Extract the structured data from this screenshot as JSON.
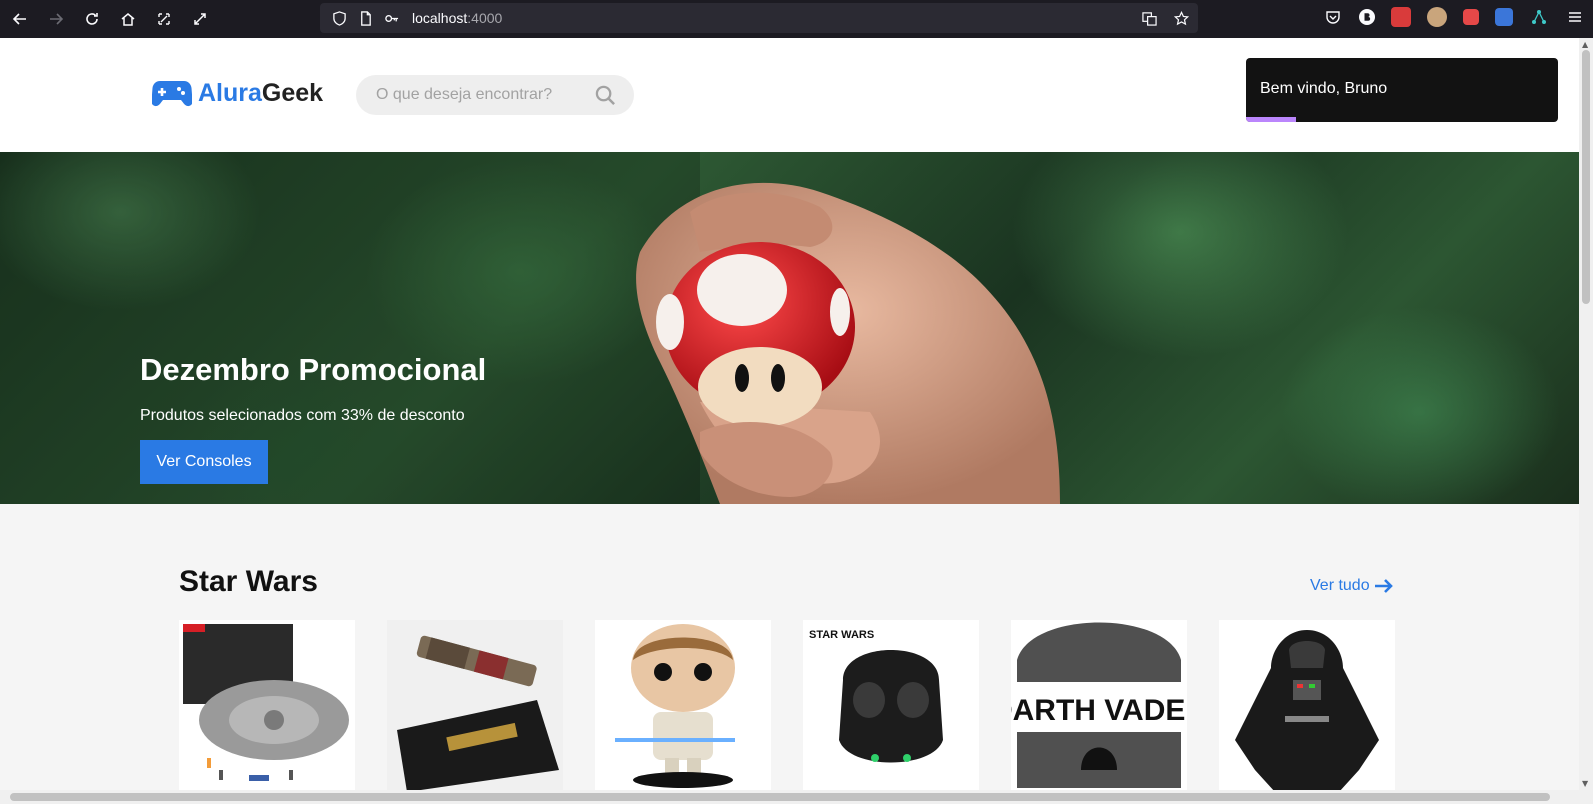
{
  "browser": {
    "url_host": "localhost",
    "url_port": ":4000"
  },
  "header": {
    "logo_prefix": "Alura",
    "logo_suffix": "Geek",
    "search_placeholder": "O que deseja encontrar?"
  },
  "toast": {
    "message": "Bem vindo, Bruno",
    "progress": 0.16
  },
  "hero": {
    "title": "Dezembro Promocional",
    "subtitle": "Produtos selecionados com 33% de desconto",
    "button_label": "Ver Consoles"
  },
  "section": {
    "title": "Star Wars",
    "see_all_label": "Ver tudo"
  },
  "products": {
    "helmet_brand_label": "STAR WARS",
    "beanie_text": "DARTH VADER"
  },
  "colors": {
    "accent": "#2a7ae4",
    "toast_bg": "#121212",
    "toast_progress": "#bb86fc"
  }
}
